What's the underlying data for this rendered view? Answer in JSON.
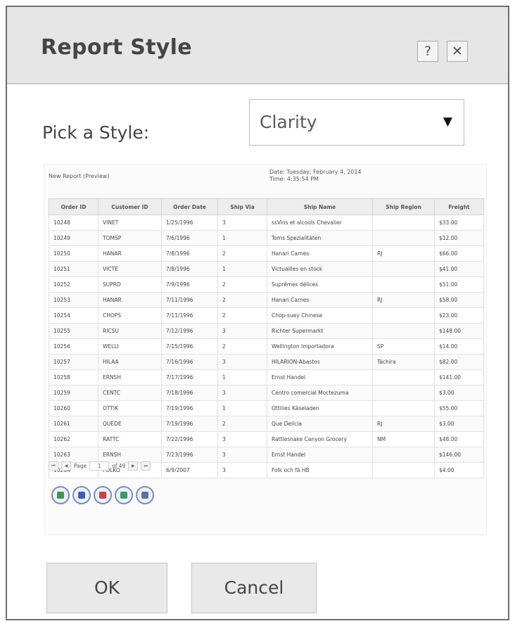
{
  "dialog": {
    "title": "Report Style",
    "help_label": "?",
    "close_label": "✕"
  },
  "style_picker": {
    "label": "Pick a Style:",
    "selected": "Clarity",
    "arrow": "▼"
  },
  "preview": {
    "title": "New Report (Preview)",
    "date_line": "Date:  Tuesday, February 4, 2014",
    "time_line": "Time:  4:35:54 PM",
    "columns": [
      "Order ID",
      "Customer ID",
      "Order Date",
      "Ship Via",
      "Ship Name",
      "Ship Region",
      "Freight"
    ],
    "rows": [
      [
        "10248",
        "VINET",
        "1/25/1996",
        "3",
        "ssVins et alcools Chevalier",
        "",
        "$33.00"
      ],
      [
        "10249",
        "TOMSP",
        "7/6/1996",
        "1",
        "Toms Spezialitäten",
        "",
        "$12.00"
      ],
      [
        "10250",
        "HANAR",
        "7/8/1996",
        "2",
        "Hanari Carnes",
        "RJ",
        "$66.00"
      ],
      [
        "10251",
        "VICTE",
        "7/8/1996",
        "1",
        "Victuailles en stock",
        "",
        "$41.00"
      ],
      [
        "10252",
        "SUPRD",
        "7/9/1996",
        "2",
        "Suprêmes délices",
        "",
        "$51.00"
      ],
      [
        "10253",
        "HANAR",
        "7/11/1996",
        "2",
        "Hanari Carnes",
        "RJ",
        "$58.00"
      ],
      [
        "10254",
        "CHOPS",
        "7/11/1996",
        "2",
        "Chop-suey Chinese",
        "",
        "$23.00"
      ],
      [
        "10255",
        "RICSU",
        "7/12/1996",
        "3",
        "Richter Supermarkt",
        "",
        "$148.00"
      ],
      [
        "10256",
        "WELLI",
        "7/15/1996",
        "2",
        "Wellington Importadora",
        "SP",
        "$14.00"
      ],
      [
        "10257",
        "HILAA",
        "7/16/1996",
        "3",
        "HILARION-Abastos",
        "Táchira",
        "$82.00"
      ],
      [
        "10258",
        "ERNSH",
        "7/17/1996",
        "1",
        "Ernst Handel",
        "",
        "$141.00"
      ],
      [
        "10259",
        "CENTC",
        "7/18/1996",
        "3",
        "Centro comercial Moctezuma",
        "",
        "$3.00"
      ],
      [
        "10260",
        "OTTIK",
        "7/19/1996",
        "1",
        "Ottilies Käseladen",
        "",
        "$55.00"
      ],
      [
        "10261",
        "QUEDE",
        "7/19/1996",
        "2",
        "Que Delícia",
        "RJ",
        "$3.00"
      ],
      [
        "10262",
        "RATTC",
        "7/22/1996",
        "3",
        "Rattlesnake Canyon Grocery",
        "NM",
        "$48.00"
      ],
      [
        "10263",
        "ERNSH",
        "7/23/1996",
        "3",
        "Ernst Handel",
        "",
        "$146.00"
      ],
      [
        "10264",
        "FOLKO",
        "6/9/2007",
        "3",
        "Folk och fä HB",
        "",
        "$4.00"
      ]
    ],
    "pager": {
      "first": "⏮",
      "prev": "◀",
      "page_label": "Page",
      "page_value": "1",
      "of_label": "of 49",
      "next": "▶",
      "last": "⏭"
    },
    "export_icons": [
      {
        "name": "export-excel-icon",
        "color": "#3a9a4a"
      },
      {
        "name": "export-word-icon",
        "color": "#3a5bbf"
      },
      {
        "name": "export-pdf-icon",
        "color": "#d04040"
      },
      {
        "name": "export-csv-icon",
        "color": "#3a9a6a"
      },
      {
        "name": "export-html-icon",
        "color": "#5a6fb0"
      }
    ]
  },
  "buttons": {
    "ok": "OK",
    "cancel": "Cancel"
  }
}
